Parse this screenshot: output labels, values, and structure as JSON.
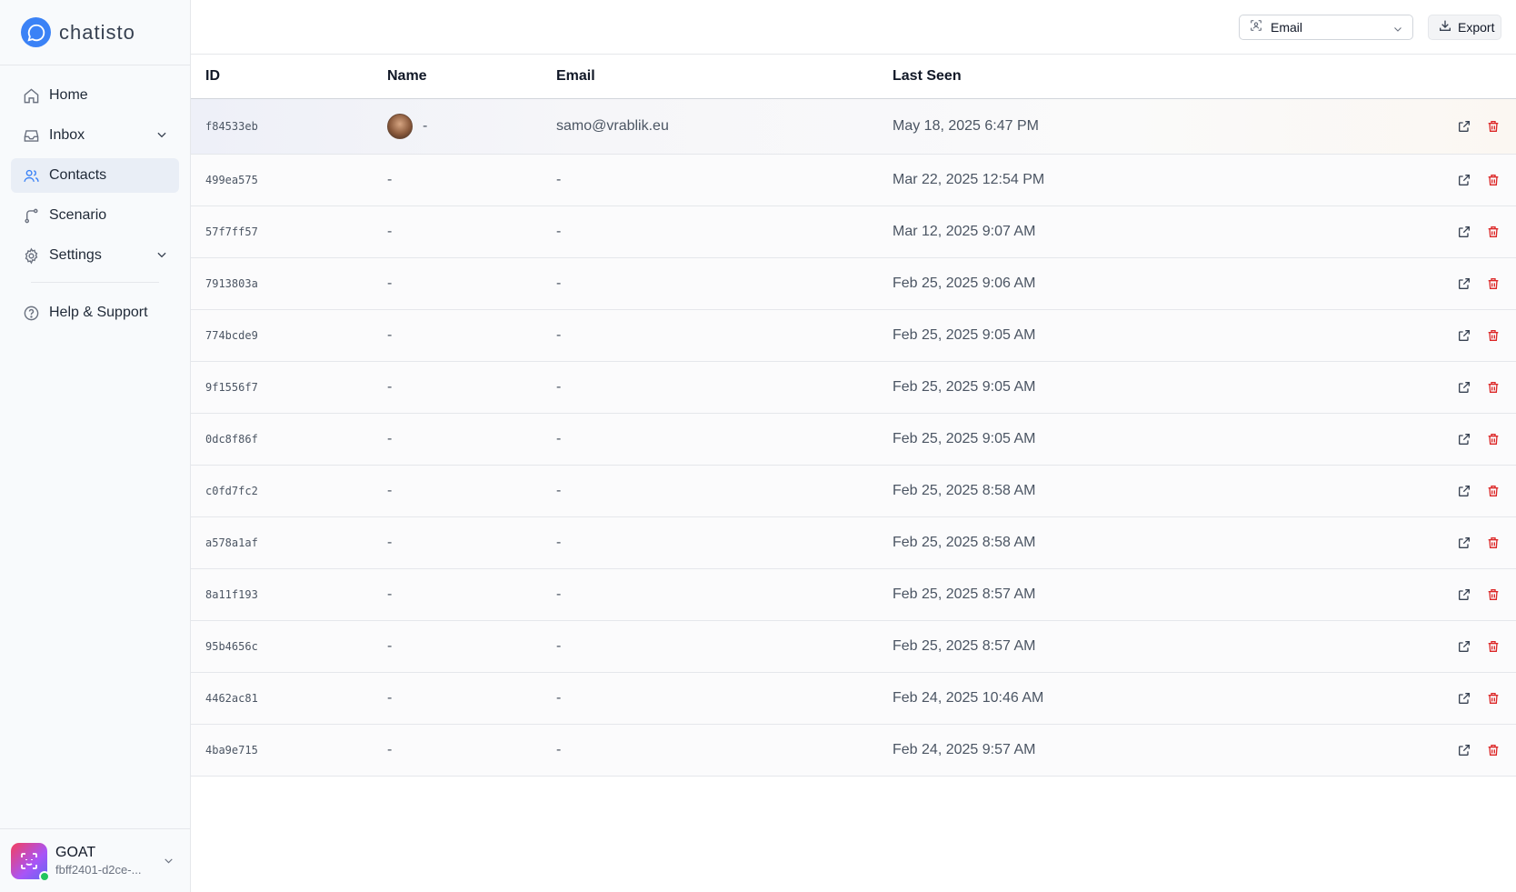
{
  "brand": {
    "name": "chatisto"
  },
  "nav": {
    "home": "Home",
    "inbox": "Inbox",
    "contacts": "Contacts",
    "scenario": "Scenario",
    "settings": "Settings",
    "help": "Help & Support",
    "active": "Contacts"
  },
  "org": {
    "name": "GOAT",
    "id": "fbff2401-d2ce-..."
  },
  "toolbar": {
    "filter_value": "Email",
    "export_label": "Export"
  },
  "table": {
    "headers": {
      "id": "ID",
      "name": "Name",
      "email": "Email",
      "last_seen": "Last Seen"
    },
    "rows": [
      {
        "id": "f84533eb",
        "name": "-",
        "email": "samo@vrablik.eu",
        "last_seen": "May 18, 2025 6:47 PM",
        "has_avatar": true
      },
      {
        "id": "499ea575",
        "name": "-",
        "email": "-",
        "last_seen": "Mar 22, 2025 12:54 PM"
      },
      {
        "id": "57f7ff57",
        "name": "-",
        "email": "-",
        "last_seen": "Mar 12, 2025 9:07 AM"
      },
      {
        "id": "7913803a",
        "name": "-",
        "email": "-",
        "last_seen": "Feb 25, 2025 9:06 AM"
      },
      {
        "id": "774bcde9",
        "name": "-",
        "email": "-",
        "last_seen": "Feb 25, 2025 9:05 AM"
      },
      {
        "id": "9f1556f7",
        "name": "-",
        "email": "-",
        "last_seen": "Feb 25, 2025 9:05 AM"
      },
      {
        "id": "0dc8f86f",
        "name": "-",
        "email": "-",
        "last_seen": "Feb 25, 2025 9:05 AM"
      },
      {
        "id": "c0fd7fc2",
        "name": "-",
        "email": "-",
        "last_seen": "Feb 25, 2025 8:58 AM"
      },
      {
        "id": "a578a1af",
        "name": "-",
        "email": "-",
        "last_seen": "Feb 25, 2025 8:58 AM"
      },
      {
        "id": "8a11f193",
        "name": "-",
        "email": "-",
        "last_seen": "Feb 25, 2025 8:57 AM"
      },
      {
        "id": "95b4656c",
        "name": "-",
        "email": "-",
        "last_seen": "Feb 25, 2025 8:57 AM"
      },
      {
        "id": "4462ac81",
        "name": "-",
        "email": "-",
        "last_seen": "Feb 24, 2025 10:46 AM"
      },
      {
        "id": "4ba9e715",
        "name": "-",
        "email": "-",
        "last_seen": "Feb 24, 2025 9:57 AM"
      }
    ]
  },
  "colors": {
    "brand": "#3b82f6",
    "delete": "#dc2626",
    "active_nav": "#e9eef6"
  },
  "icons": {
    "home": "home-icon",
    "inbox": "inbox-icon",
    "contacts": "users-icon",
    "scenario": "branch-icon",
    "settings": "gear-icon",
    "help": "help-circle-icon",
    "export": "download-icon",
    "open": "external-link-icon",
    "delete": "trash-icon",
    "filter": "scan-icon"
  }
}
